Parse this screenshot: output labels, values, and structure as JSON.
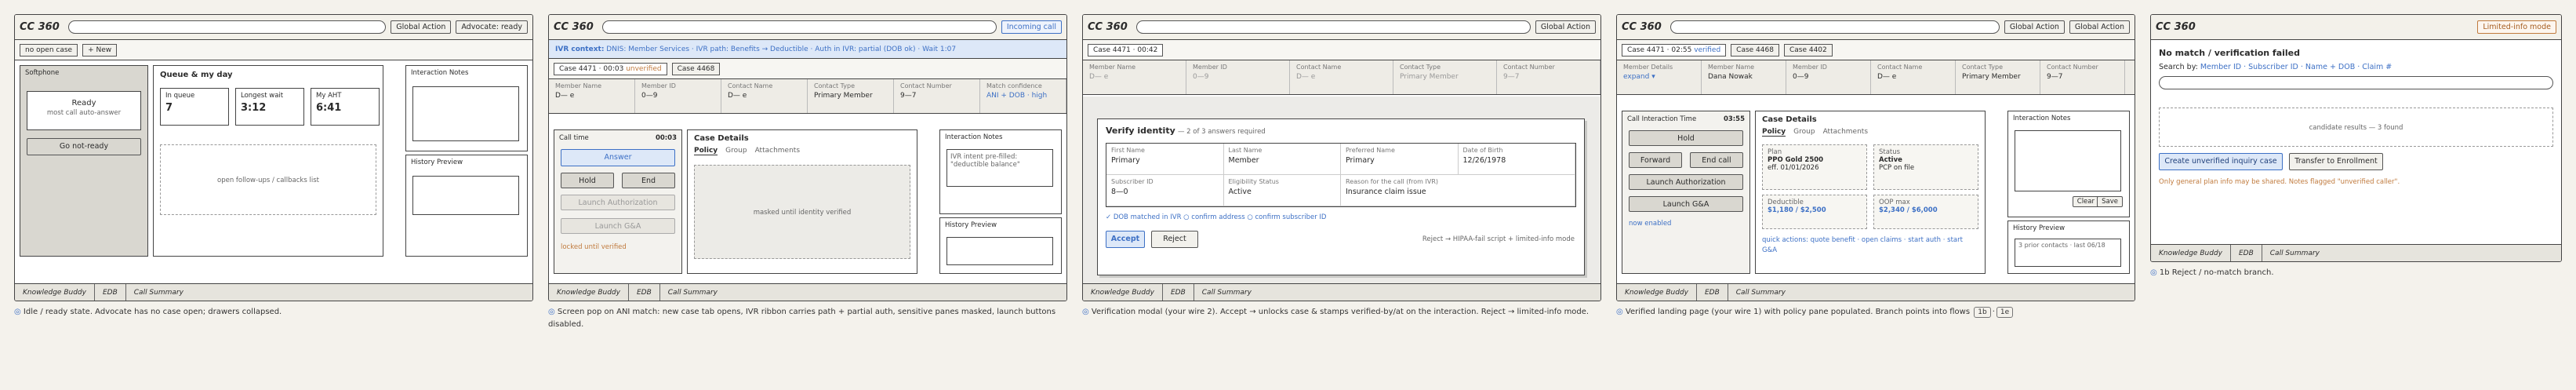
{
  "p1": {
    "logo": "CC 360",
    "global_action": "Global Action",
    "advocate": "Advocate: ready",
    "tab_no_open": "no open case",
    "tab_new": "+ New",
    "softphone": "Softphone",
    "ready": "Ready",
    "auto_answer": "most call auto-answer",
    "go_not_ready": "Go not-ready",
    "queue_title": "Queue & my day",
    "stats": [
      {
        "label": "In queue",
        "value": "7"
      },
      {
        "label": "Longest wait",
        "value": "3:12"
      },
      {
        "label": "My AHT",
        "value": "6:41"
      }
    ],
    "followups": "open follow-ups / callbacks list",
    "interaction_notes": "Interaction Notes",
    "history_preview": "History Preview",
    "bottom": [
      "Knowledge Buddy",
      "EDB",
      "Call Summary"
    ],
    "caption": "Idle / ready state. Advocate has no case open; drawers collapsed."
  },
  "p2": {
    "logo": "CC 360",
    "incoming": "Incoming call",
    "ivr_context": "IVR context:",
    "ivr_rest": "DNIS: Member Services · IVR path: Benefits → Deductible · Auth in IVR: partial (DOB ok) · Wait 1:07",
    "tab_case": "Case 4471 · 00:03",
    "tab_unverified": "unverified",
    "tab_case2": "Case 4468",
    "fields": [
      {
        "l": "Member Name",
        "v": "D— e"
      },
      {
        "l": "Member ID",
        "v": "0—9"
      },
      {
        "l": "Contact Name",
        "v": "D— e"
      },
      {
        "l": "Contact Type",
        "v": "Primary Member"
      },
      {
        "l": "Contact Number",
        "v": "9—7"
      },
      {
        "l": "Match confidence",
        "v": "ANI + DOB · high"
      }
    ],
    "call_time": "Call time",
    "call_time_v": "00:03",
    "answer": "Answer",
    "hold": "Hold",
    "end": "End",
    "launch_auth": "Launch Authorization",
    "launch_ga": "Launch G&A",
    "locked": "locked until verified",
    "case_details": "Case Details",
    "tabs": [
      "Policy",
      "Group",
      "Attachments"
    ],
    "masked": "masked until identity verified",
    "interaction_notes": "Interaction Notes",
    "ivr_note": "IVR intent pre-filled: \"deductible balance\"",
    "history_preview": "History Preview",
    "bottom": [
      "Knowledge Buddy",
      "EDB",
      "Call Summary"
    ],
    "caption": "Screen pop on ANI match: new case tab opens, IVR ribbon carries path + partial auth, sensitive panes masked, launch buttons disabled."
  },
  "p3": {
    "logo": "CC 360",
    "global_action": "Global Action",
    "tab_case": "Case 4471 · 00:42",
    "fields": [
      {
        "l": "Member Name",
        "v": "D— e"
      },
      {
        "l": "Member ID",
        "v": "0—9"
      },
      {
        "l": "Contact Name",
        "v": "D— e"
      },
      {
        "l": "Contact Type",
        "v": "Primary Member"
      },
      {
        "l": "Contact Number",
        "v": "9—7"
      }
    ],
    "modal_title": "Verify identity",
    "modal_sub": "— 2 of 3 answers required",
    "grid": [
      {
        "l": "First Name",
        "v": "Primary"
      },
      {
        "l": "Last Name",
        "v": "Member"
      },
      {
        "l": "Preferred Name",
        "v": "Primary"
      },
      {
        "l": "Date of Birth",
        "v": "12/26/1978"
      },
      {
        "l": "Subscriber ID",
        "v": "8—0"
      },
      {
        "l": "Eligibility Status",
        "v": "Active"
      },
      {
        "l": "Reason for the call (from IVR)",
        "v": "Insurance claim issue"
      }
    ],
    "checks": "✓ DOB matched in IVR   ○ confirm address   ○ confirm subscriber ID",
    "accept": "Accept",
    "reject": "Reject",
    "reject_note": "Reject → HIPAA-fail script + limited-info mode",
    "bottom": [
      "Knowledge Buddy",
      "EDB",
      "Call Summary"
    ],
    "caption": "Verification modal (your wire 2). Accept → unlocks case & stamps verified-by/at on the interaction. Reject → limited-info mode."
  },
  "p4": {
    "logo": "CC 360",
    "global_action": "Global Action",
    "global_action2": "Global Action",
    "tab_case": "Case 4471 · 02:55",
    "tab_verified": "verified",
    "tab_case2": "Case 4468",
    "tab_case3": "Case 4402",
    "fields": [
      {
        "l": "Member Details",
        "v": "expand ▾"
      },
      {
        "l": "Member Name",
        "v": "Dana Nowak"
      },
      {
        "l": "Member ID",
        "v": "0—9"
      },
      {
        "l": "Contact Name",
        "v": "D— e"
      },
      {
        "l": "Contact Type",
        "v": "Primary Member"
      },
      {
        "l": "Contact Number",
        "v": "9—7"
      }
    ],
    "cit": "Call Interaction Time",
    "cit_v": "03:55",
    "hold": "Hold",
    "forward": "Forward",
    "end_call": "End call",
    "launch_auth": "Launch Authorization",
    "launch_ga": "Launch G&A",
    "now_enabled": "now enabled",
    "case_details": "Case Details",
    "tabs": [
      "Policy",
      "Group",
      "Attachments"
    ],
    "plan_l": "Plan",
    "plan_v": "PPO Gold 2500",
    "plan_s": "eff. 01/01/2026",
    "status_l": "Status",
    "status_v": "Active",
    "status_s": "PCP on file",
    "ded_l": "Deductible",
    "ded_v": "$1,180 / $2,500",
    "oop_l": "OOP max",
    "oop_v": "$2,340 / $6,000",
    "quick": "quick actions: quote benefit · open claims · start auth · start G&A",
    "interaction_notes": "Interaction Notes",
    "clear": "Clear",
    "save": "Save",
    "history_preview": "History Preview",
    "history_note": "3 prior contacts · last 06/18",
    "bottom": [
      "Knowledge Buddy",
      "EDB",
      "Call Summary"
    ],
    "caption": "Verified landing page (your wire 1) with policy pane populated. Branch points into flows",
    "pill1": "1b",
    "pill_sep": "·",
    "pill2": "1e"
  },
  "p5": {
    "logo": "CC 360",
    "limited": "Limited-info mode",
    "title": "No match / verification failed",
    "search_by": "Search by:",
    "search_opts": "Member ID · Subscriber ID · Name + DOB · Claim #",
    "candidates": "candidate results — 3 found",
    "create": "Create unverified inquiry case",
    "transfer": "Transfer to Enrollment",
    "warning": "Only general plan info may be shared. Notes flagged \"unverified caller\".",
    "bottom": [
      "Knowledge Buddy",
      "EDB",
      "Call Summary"
    ],
    "caption": "1b Reject / no-match branch."
  },
  "colors": {
    "accent": "#3d70c5",
    "warn": "#c07a3d",
    "border": "#444444",
    "muted_bg": "#d9d7d0"
  }
}
